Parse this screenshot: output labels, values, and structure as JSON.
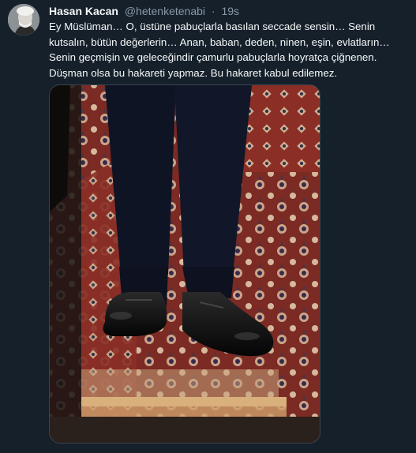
{
  "tweet": {
    "author_name": "Hasan Kacan",
    "handle": "@hetenketenabi",
    "separator": "·",
    "time": "19s",
    "text_lines": [
      "Ey Müslüman… O, üstüne pabuçlarla basılan seccade sensin… Senin",
      "kutsalın, bütün değerlerin… Anan, baban, deden, ninen, eşin, evlatların…",
      "Senin geçmişin ve geleceğindir çamurlu pabuçlarla hoyratça çiğnenen.",
      "Düşman olsa bu hakareti yapmaz. Bu hakaret kabul edilemez."
    ]
  },
  "media": {
    "description_icon": "photo-of-shoes-on-prayer-rug"
  },
  "colors": {
    "background": "#15202b",
    "text_primary": "#f7f9f9",
    "text_secondary": "#8b98a5",
    "border": "#38444d"
  }
}
